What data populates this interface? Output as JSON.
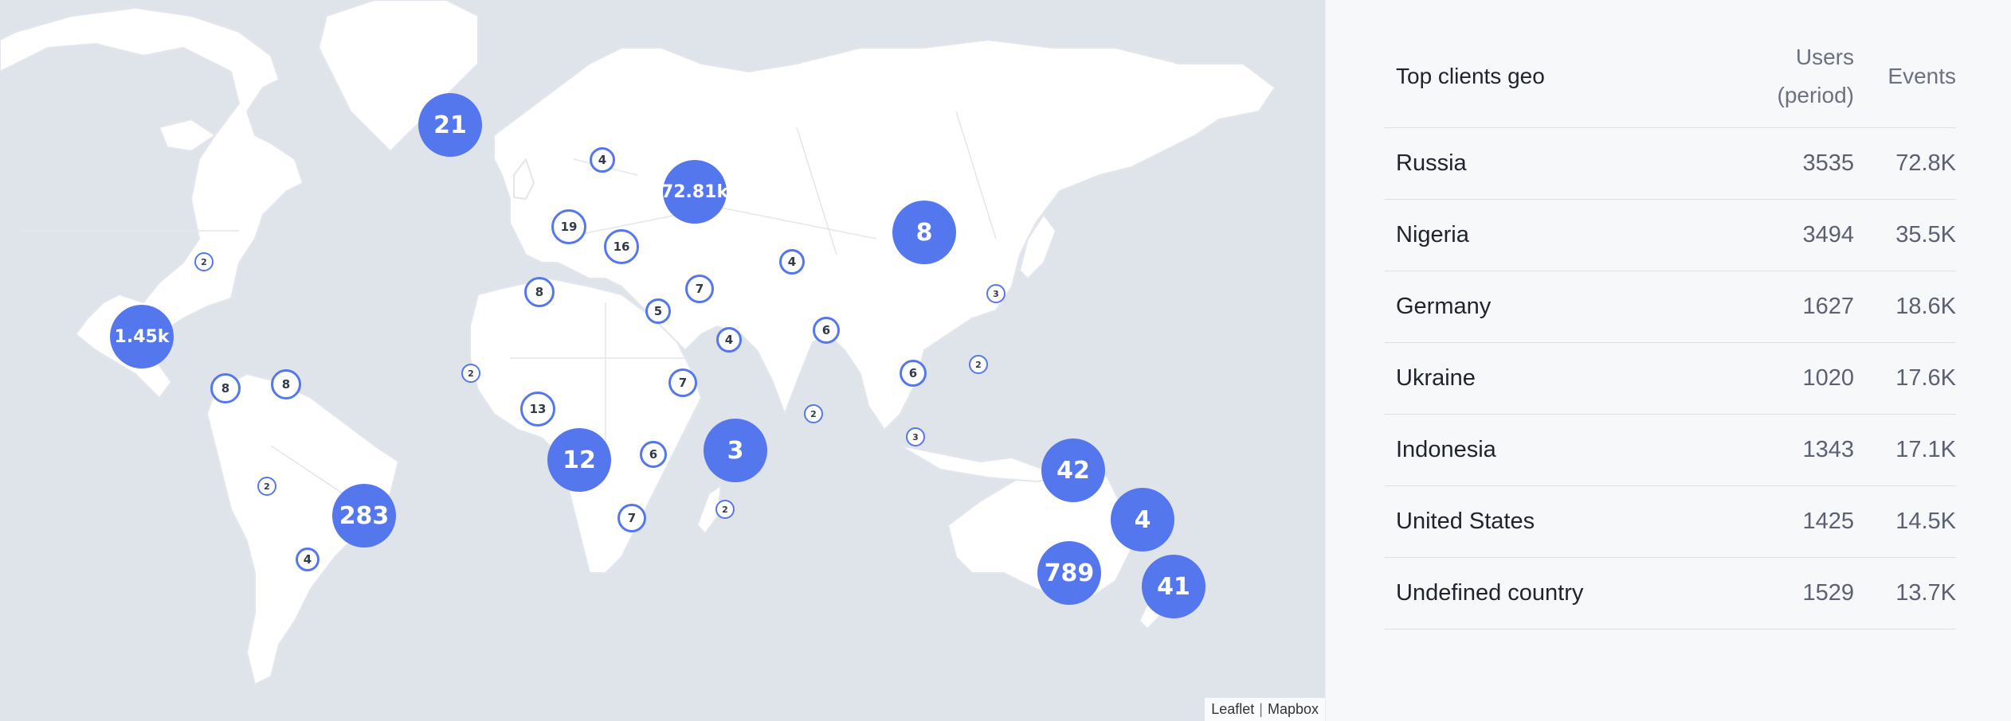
{
  "map": {
    "markers": [
      {
        "label": "21",
        "kind": "big"
      },
      {
        "label": "72.81k",
        "kind": "big-mid"
      },
      {
        "label": "8",
        "kind": "big"
      },
      {
        "label": "1.45k",
        "kind": "big-mid"
      },
      {
        "label": "283",
        "kind": "big"
      },
      {
        "label": "12",
        "kind": "big"
      },
      {
        "label": "3",
        "kind": "big"
      },
      {
        "label": "42",
        "kind": "big"
      },
      {
        "label": "4",
        "kind": "big"
      },
      {
        "label": "789",
        "kind": "big"
      },
      {
        "label": "41",
        "kind": "big"
      },
      {
        "label": "4",
        "kind": "small"
      },
      {
        "label": "19",
        "kind": "small"
      },
      {
        "label": "16",
        "kind": "small"
      },
      {
        "label": "2",
        "kind": "tiny"
      },
      {
        "label": "8",
        "kind": "small"
      },
      {
        "label": "7",
        "kind": "small"
      },
      {
        "label": "5",
        "kind": "small"
      },
      {
        "label": "4",
        "kind": "small"
      },
      {
        "label": "4",
        "kind": "small"
      },
      {
        "label": "6",
        "kind": "small"
      },
      {
        "label": "3",
        "kind": "tiny"
      },
      {
        "label": "2",
        "kind": "tiny"
      },
      {
        "label": "13",
        "kind": "small"
      },
      {
        "label": "7",
        "kind": "small"
      },
      {
        "label": "6",
        "kind": "small"
      },
      {
        "label": "2",
        "kind": "tiny"
      },
      {
        "label": "6",
        "kind": "small"
      },
      {
        "label": "2",
        "kind": "tiny"
      },
      {
        "label": "3",
        "kind": "tiny"
      },
      {
        "label": "8",
        "kind": "small"
      },
      {
        "label": "8",
        "kind": "small"
      },
      {
        "label": "2",
        "kind": "tiny"
      },
      {
        "label": "4",
        "kind": "small"
      },
      {
        "label": "7",
        "kind": "small"
      },
      {
        "label": "2",
        "kind": "tiny"
      }
    ],
    "attribution": {
      "leaflet": "Leaflet",
      "separator": "|",
      "mapbox": "Mapbox"
    },
    "colors": {
      "marker": "#5477ee",
      "water": "#dfe3ea",
      "land": "#ffffff",
      "border": "#dfe2e8"
    }
  },
  "table": {
    "title": "Top clients geo",
    "col_users_line1": "Users",
    "col_users_line2": "(period)",
    "col_events": "Events",
    "rows": [
      {
        "country": "Russia",
        "users": "3535",
        "events": "72.8K"
      },
      {
        "country": "Nigeria",
        "users": "3494",
        "events": "35.5K"
      },
      {
        "country": "Germany",
        "users": "1627",
        "events": "18.6K"
      },
      {
        "country": "Ukraine",
        "users": "1020",
        "events": "17.6K"
      },
      {
        "country": "Indonesia",
        "users": "1343",
        "events": "17.1K"
      },
      {
        "country": "United States",
        "users": "1425",
        "events": "14.5K"
      },
      {
        "country": "Undefined country",
        "users": "1529",
        "events": "13.7K"
      }
    ]
  }
}
